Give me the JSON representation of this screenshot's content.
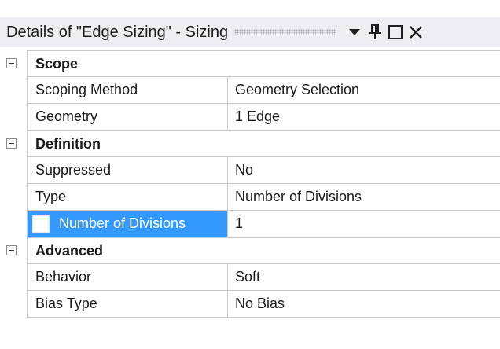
{
  "window": {
    "title": "Details of \"Edge Sizing\" - Sizing",
    "buttons": {
      "dropdown_icon": "chevron-down-icon",
      "pin_icon": "pin-icon",
      "maximize_icon": "maximize-icon",
      "close_icon": "close-icon"
    }
  },
  "colors": {
    "selection": "#3399ff",
    "titlebar_bg": "#eeeef2",
    "grid_line": "#c9c9c9"
  },
  "grid": {
    "scope": {
      "label": "Scope",
      "rows": [
        {
          "name": "Scoping Method",
          "value": "Geometry Selection"
        },
        {
          "name": "Geometry",
          "value": "1 Edge"
        }
      ]
    },
    "definition": {
      "label": "Definition",
      "rows": [
        {
          "name": "Suppressed",
          "value": "No"
        },
        {
          "name": "Type",
          "value": "Number of Divisions"
        },
        {
          "name": "Number of Divisions",
          "value": "1",
          "selected": true,
          "parameter_checked": false
        }
      ]
    },
    "advanced": {
      "label": "Advanced",
      "rows": [
        {
          "name": "Behavior",
          "value": "Soft"
        },
        {
          "name": "Bias Type",
          "value": "No Bias"
        }
      ]
    }
  }
}
